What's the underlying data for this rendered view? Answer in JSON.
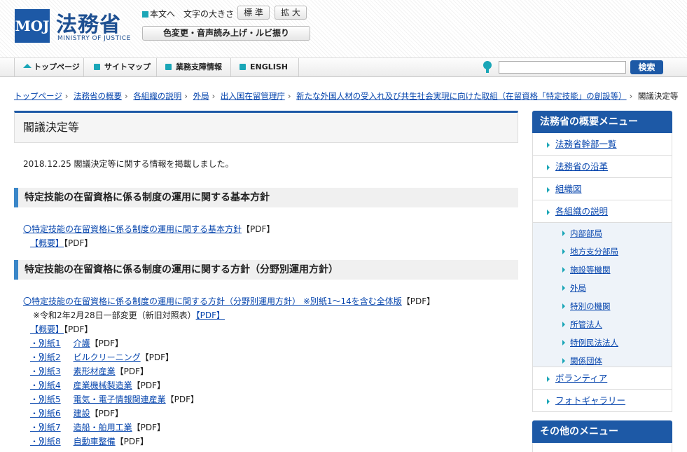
{
  "header": {
    "logo_mark": "MOJ",
    "logo_title": "法務省",
    "logo_sub": "MINISTRY OF JUSTICE",
    "skip_link": "本文へ",
    "font_size_label": "文字の大きさ",
    "font_standard": "標 準",
    "font_large": "拡 大",
    "accessibility": "色変更・音声読み上げ・ルビ振り"
  },
  "nav": {
    "home": "トップページ",
    "sitemap": "サイトマップ",
    "business": "業務支障情報",
    "english": "ENGLISH",
    "search_button": "検索",
    "search_value": ""
  },
  "breadcrumb": [
    "トップページ",
    "法務省の概要",
    "各組織の説明",
    "外局",
    "出入国在留管理庁",
    "新たな外国人材の受入れ及び共生社会実現に向けた取組（在留資格「特定技能」の創設等）",
    "閣議決定等"
  ],
  "main": {
    "title": "閣議決定等",
    "notice": "2018.12.25 閣議決定等に関する情報を掲載しました。",
    "section1": {
      "heading": "特定技能の在留資格に係る制度の運用に関する基本方針",
      "link1": "〇特定技能の在留資格に係る制度の運用に関する基本方針",
      "link2": "【概要】",
      "pdf": "【PDF】"
    },
    "section2": {
      "heading": "特定技能の在留資格に係る制度の運用に関する方針（分野別運用方針）",
      "main_link": "〇特定技能の在留資格に係る制度の運用に関する方針（分野別運用方針） ※別紙1～14を含む全体版",
      "revision_text": "※令和2年2月28日一部変更（新旧対照表）",
      "revision_link": "【PDF】",
      "summary_link": "【概要】",
      "pdf": "【PDF】",
      "attachments": [
        {
          "no": "・別紙1",
          "name": "介護"
        },
        {
          "no": "・別紙2",
          "name": "ビルクリーニング"
        },
        {
          "no": "・別紙3",
          "name": "素形材産業"
        },
        {
          "no": "・別紙4",
          "name": "産業機械製造業"
        },
        {
          "no": "・別紙5",
          "name": "電気・電子情報関連産業"
        },
        {
          "no": "・別紙6",
          "name": "建設"
        },
        {
          "no": "・別紙7",
          "name": "造船・舶用工業"
        },
        {
          "no": "・別紙8",
          "name": "自動車整備"
        }
      ]
    }
  },
  "sidebar": {
    "heading": "法務省の概要メニュー",
    "items": [
      "法務省幹部一覧",
      "法務省の沿革",
      "組織図",
      "各組織の説明"
    ],
    "subitems": [
      "内部部局",
      "地方支分部局",
      "施設等機関",
      "外局",
      "特別の機関",
      "所管法人",
      "特例民法法人",
      "関係団体"
    ],
    "items_after": [
      "ボランティア",
      "フォトギャラリー"
    ],
    "other_heading": "その他のメニュー"
  }
}
